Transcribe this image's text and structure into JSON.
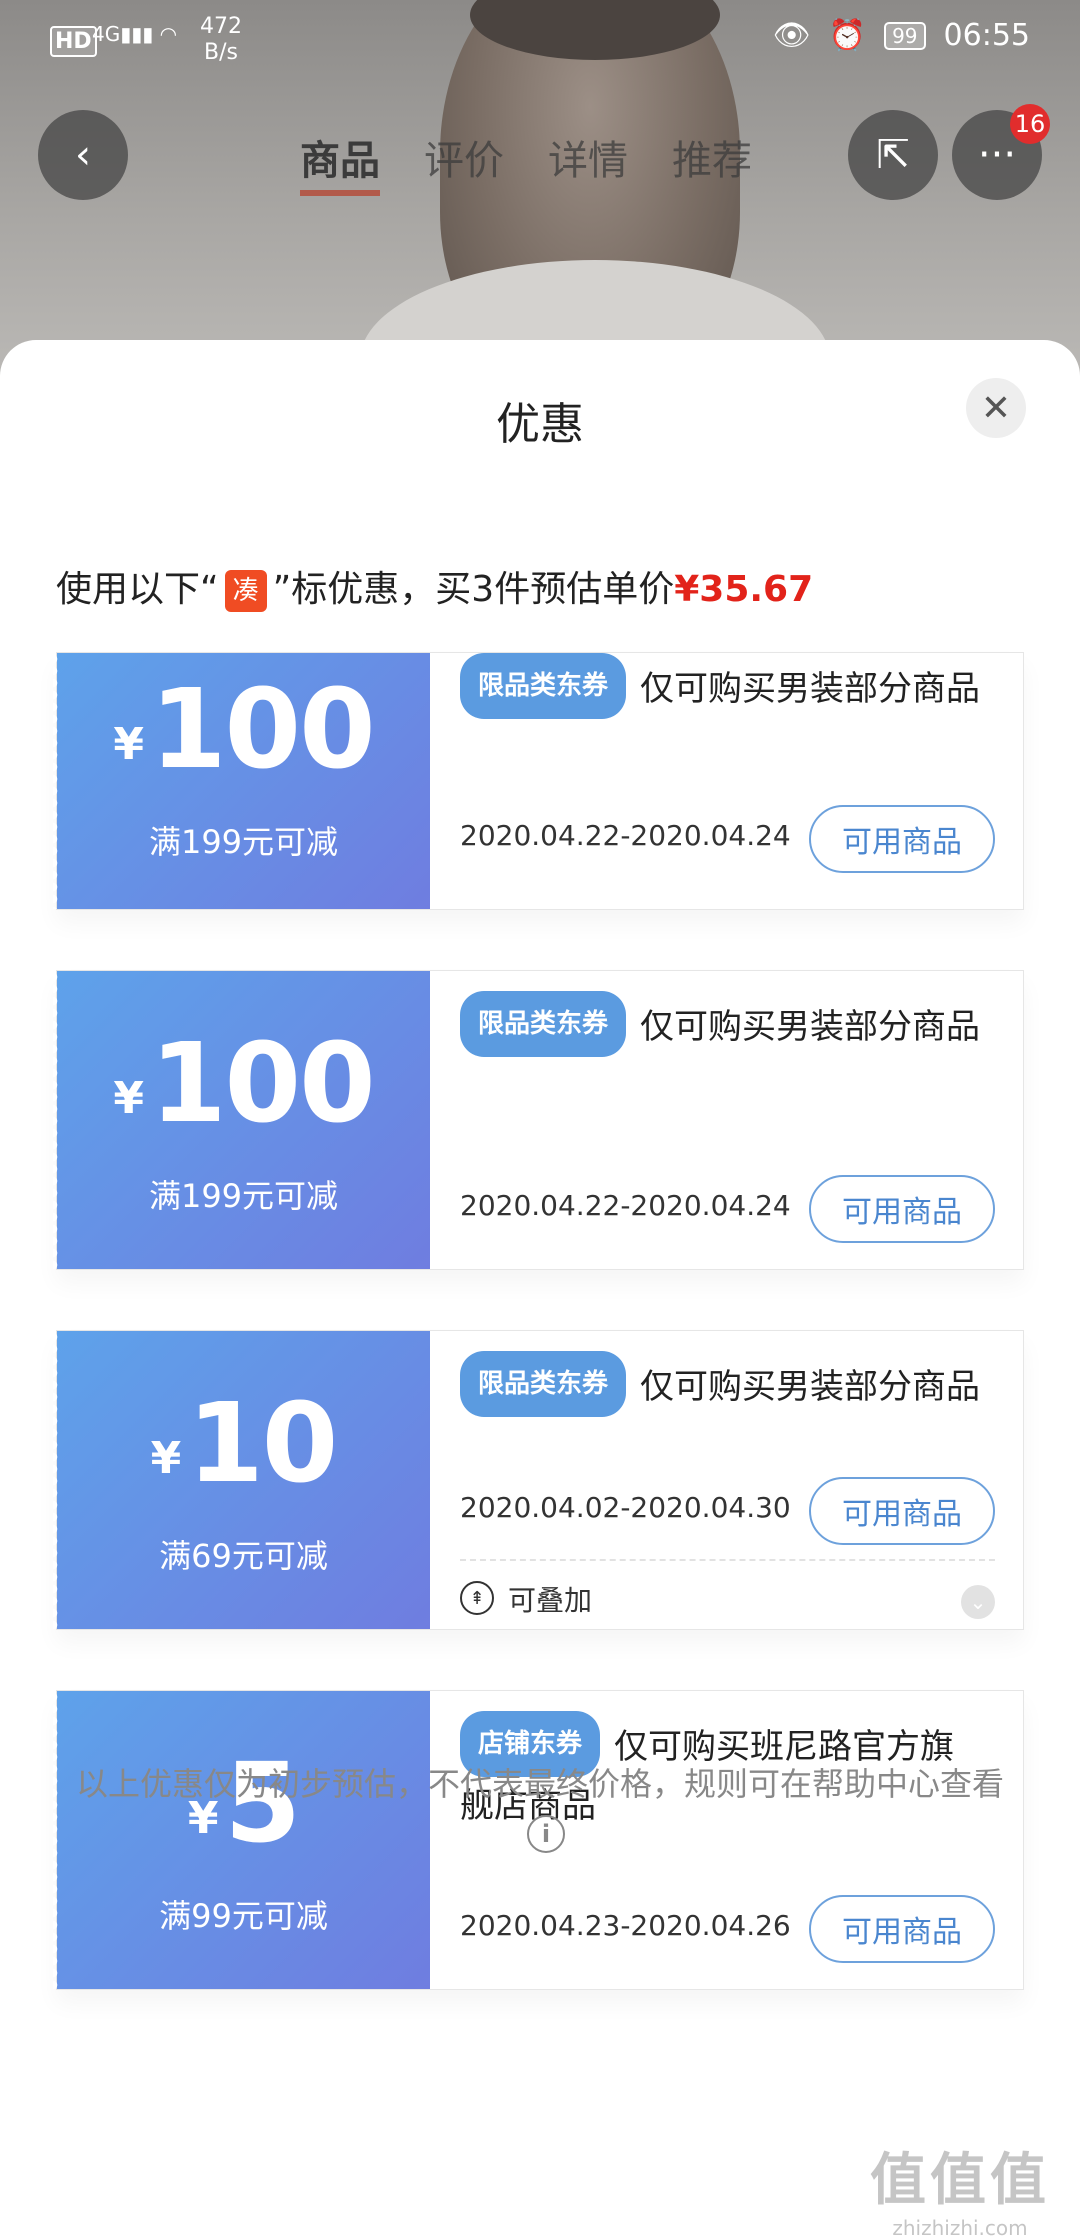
{
  "status_bar": {
    "network": "HD",
    "signal": "4G",
    "speed_value": "472",
    "speed_unit": "B/s",
    "battery": "99",
    "time": "06:55"
  },
  "product_nav": {
    "tabs": [
      "商品",
      "评价",
      "详情",
      "推荐"
    ],
    "active_tab": "商品",
    "more_badge": "16"
  },
  "sheet": {
    "title": "优惠",
    "close": "✕",
    "intro": {
      "prefix": "使用以下“",
      "tag": "凑",
      "suffix": "”标优惠，买3件预估单价",
      "price": "¥35.67"
    }
  },
  "coupons": [
    {
      "currency": "¥",
      "amount": "100",
      "condition": "满199元可减",
      "tag": "限品类东券",
      "desc": "仅可购买男装部分商品",
      "dates": "2020.04.22-2020.04.24",
      "button": "可用商品"
    },
    {
      "currency": "¥",
      "amount": "100",
      "condition": "满199元可减",
      "tag": "限品类东券",
      "desc": "仅可购买男装部分商品",
      "dates": "2020.04.22-2020.04.24",
      "button": "可用商品"
    },
    {
      "currency": "¥",
      "amount": "10",
      "condition": "满69元可减",
      "tag": "限品类东券",
      "desc": "仅可购买男装部分商品",
      "dates": "2020.04.02-2020.04.30",
      "button": "可用商品",
      "stack_label": "可叠加"
    },
    {
      "currency": "¥",
      "amount": "5",
      "condition": "满99元可减",
      "tag": "店铺东券",
      "desc": "仅可购买班尼路官方旗舰店商品",
      "dates": "2020.04.23-2020.04.26",
      "button": "可用商品"
    }
  ],
  "footer": {
    "note": "以上优惠仅为初步预估，不代表最终价格，规则可在帮助中心查看"
  },
  "watermark": {
    "logo": "值值值",
    "url": "zhizhizhi.com"
  }
}
